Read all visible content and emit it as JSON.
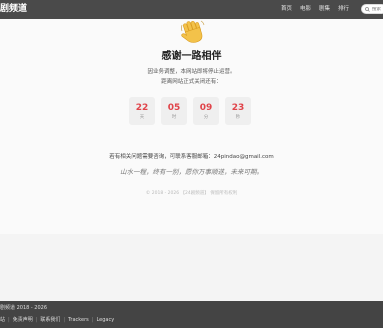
{
  "header": {
    "brand": "剧频道",
    "nav": [
      "首页",
      "电影",
      "剧集",
      "排行"
    ],
    "search_placeholder": "搜索"
  },
  "farewell": {
    "wave_emoji": "👋",
    "title": "感谢一路相伴",
    "notice_line1": "因业务调整，本网站即将停止运营。",
    "notice_line2": "距离网站正式关闭还有：",
    "countdown": [
      {
        "value": "22",
        "unit": "天"
      },
      {
        "value": "05",
        "unit": "时"
      },
      {
        "value": "09",
        "unit": "分"
      },
      {
        "value": "23",
        "unit": "秒"
      }
    ],
    "contact": "若有相关问题需要咨询，可联系客服邮箱：24pindao@gmail.com",
    "slogan": "山水一程，终有一别，愿你万事顺遂，未来可期。",
    "copyright": "© 2018 - 2026 【24剧频道】 保留所有权利"
  },
  "footer": {
    "copyright": "剧频道 2018 - 2026",
    "links": [
      "站",
      "免责声明",
      "联系我们",
      "Trackers",
      "Legacy"
    ]
  },
  "colors": {
    "header_bg": "#4a4a4a",
    "countdown_number": "#e0444a",
    "footer_bg": "#444444"
  }
}
